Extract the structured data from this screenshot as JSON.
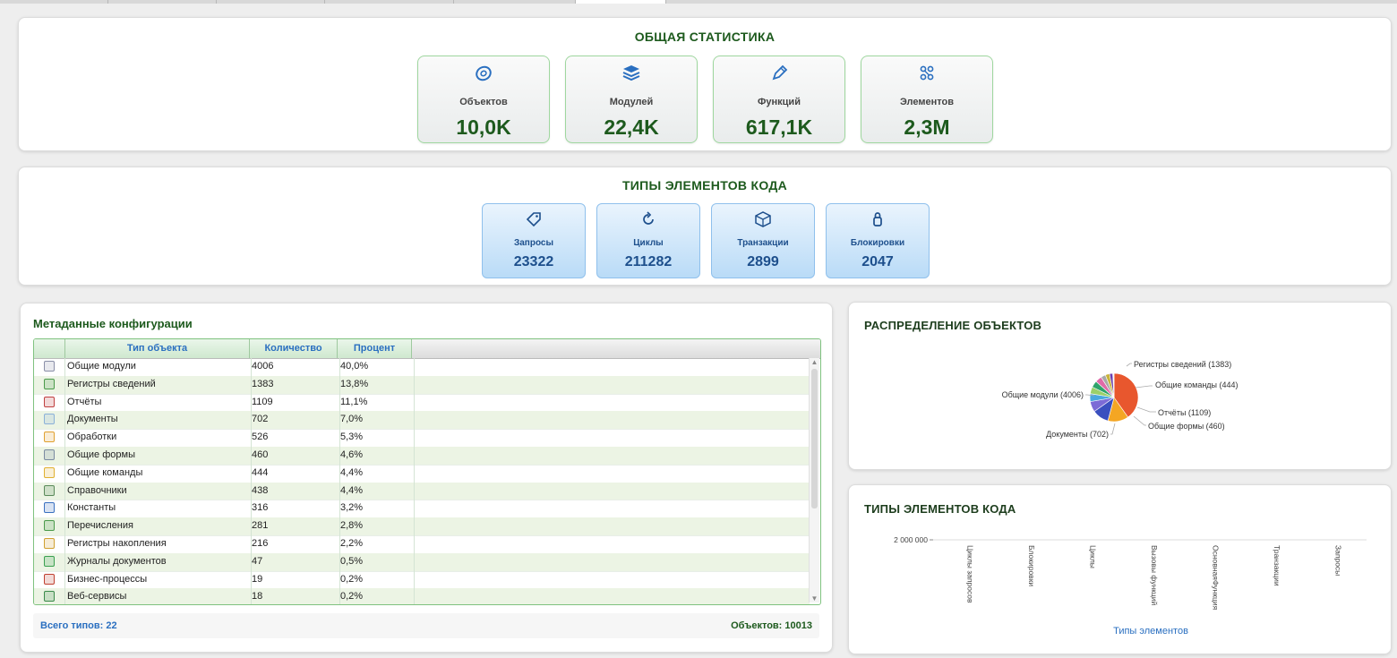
{
  "general_stats": {
    "title": "ОБЩАЯ СТАТИСТИКА",
    "cards": [
      {
        "icon": "disc-icon",
        "label": "Объектов",
        "value": "10,0K"
      },
      {
        "icon": "books-icon",
        "label": "Модулей",
        "value": "22,4K"
      },
      {
        "icon": "pencil-icon",
        "label": "Функций",
        "value": "617,1K"
      },
      {
        "icon": "link-icon",
        "label": "Элементов",
        "value": "2,3M"
      }
    ]
  },
  "code_types": {
    "title": "ТИПЫ ЭЛЕМЕНТОВ КОДА",
    "cards": [
      {
        "icon": "tag-icon",
        "label": "Запросы",
        "value": "23322"
      },
      {
        "icon": "refresh-icon",
        "label": "Циклы",
        "value": "211282"
      },
      {
        "icon": "box-icon",
        "label": "Транзакции",
        "value": "2899"
      },
      {
        "icon": "lock-icon",
        "label": "Блокировки",
        "value": "2047"
      }
    ]
  },
  "metadata": {
    "title": "Метаданные конфигурации",
    "columns": [
      "Тип объекта",
      "Количество",
      "Процент"
    ],
    "rows": [
      {
        "icon": "module-icon",
        "name": "Общие модули",
        "count": "4006",
        "percent": "40,0%"
      },
      {
        "icon": "register-icon",
        "name": "Регистры сведений",
        "count": "1383",
        "percent": "13,8%"
      },
      {
        "icon": "report-icon",
        "name": "Отчёты",
        "count": "1109",
        "percent": "11,1%"
      },
      {
        "icon": "document-icon",
        "name": "Документы",
        "count": "702",
        "percent": "7,0%"
      },
      {
        "icon": "processing-icon",
        "name": "Обработки",
        "count": "526",
        "percent": "5,3%"
      },
      {
        "icon": "form-icon",
        "name": "Общие формы",
        "count": "460",
        "percent": "4,6%"
      },
      {
        "icon": "command-icon",
        "name": "Общие команды",
        "count": "444",
        "percent": "4,4%"
      },
      {
        "icon": "catalog-icon",
        "name": "Справочники",
        "count": "438",
        "percent": "4,4%"
      },
      {
        "icon": "constant-icon",
        "name": "Константы",
        "count": "316",
        "percent": "3,2%"
      },
      {
        "icon": "enum-icon",
        "name": "Перечисления",
        "count": "281",
        "percent": "2,8%"
      },
      {
        "icon": "accumulation-icon",
        "name": "Регистры накопления",
        "count": "216",
        "percent": "2,2%"
      },
      {
        "icon": "journal-icon",
        "name": "Журналы документов",
        "count": "47",
        "percent": "0,5%"
      },
      {
        "icon": "business-process-icon",
        "name": "Бизнес-процессы",
        "count": "19",
        "percent": "0,2%"
      },
      {
        "icon": "webservice-icon",
        "name": "Веб-сервисы",
        "count": "18",
        "percent": "0,2%"
      }
    ],
    "footer_left": "Всего типов: 22",
    "footer_right": "Объектов: 10013"
  },
  "pie_panel": {
    "title": "РАСПРЕДЕЛЕНИЕ ОБЪЕКТОВ",
    "labels": {
      "modules": "Общие модули (4006)",
      "registers": "Регистры сведений (1383)",
      "commands": "Общие команды (444)",
      "reports": "Отчёты (1109)",
      "forms": "Общие формы (460)",
      "documents": "Документы (702)"
    }
  },
  "bar_panel": {
    "title": "ТИПЫ ЭЛЕМЕНТОВ КОДА",
    "y_tick": "2 000 000",
    "x_title": "Типы элементов",
    "categories": [
      "Циклы запросов",
      "Блокировки",
      "Циклы",
      "Вызовы функций",
      "ОсновнаяФункция",
      "Транзакции",
      "Запросы"
    ]
  },
  "chart_data": [
    {
      "type": "pie",
      "title": "РАСПРЕДЕЛЕНИЕ ОБЪЕКТОВ",
      "slices": [
        {
          "label": "Общие модули",
          "value": 4006,
          "color": "#e8572e"
        },
        {
          "label": "Регистры сведений",
          "value": 1383,
          "color": "#f4a623"
        },
        {
          "label": "Отчёты",
          "value": 1109,
          "color": "#3a4fbf"
        },
        {
          "label": "Документы",
          "value": 702,
          "color": "#7c6bd6"
        },
        {
          "label": "Обработки",
          "value": 526,
          "color": "#4aa8e0"
        },
        {
          "label": "Общие формы",
          "value": 460,
          "color": "#9bd06a"
        },
        {
          "label": "Общие команды",
          "value": 444,
          "color": "#2fa36b"
        },
        {
          "label": "Справочники",
          "value": 438,
          "color": "#e06aa8"
        },
        {
          "label": "Константы",
          "value": 316,
          "color": "#a8a8a8"
        },
        {
          "label": "Перечисления",
          "value": 281,
          "color": "#c8b43a"
        },
        {
          "label": "Регистры накопления",
          "value": 216,
          "color": "#6a3fb0"
        },
        {
          "label": "Журналы документов",
          "value": 47,
          "color": "#d04040"
        },
        {
          "label": "Бизнес-процессы",
          "value": 19,
          "color": "#40c0c0"
        },
        {
          "label": "Веб-сервисы",
          "value": 18,
          "color": "#705030"
        }
      ]
    },
    {
      "type": "bar",
      "title": "ТИПЫ ЭЛЕМЕНТОВ КОДА",
      "xlabel": "Типы элементов",
      "ylabel": "",
      "categories": [
        "Циклы запросов",
        "Блокировки",
        "Циклы",
        "Вызовы функций",
        "ОсновнаяФункция",
        "Транзакции",
        "Запросы"
      ],
      "yticks": [
        2000000
      ]
    }
  ]
}
